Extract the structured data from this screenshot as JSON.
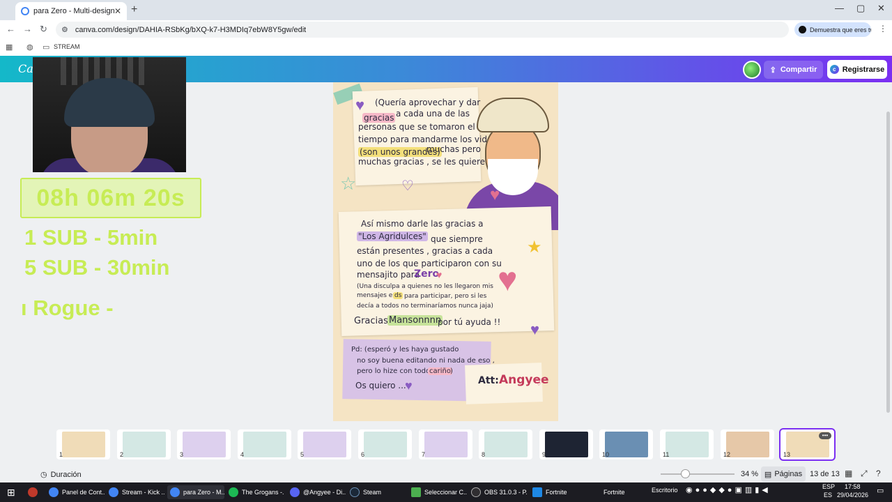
{
  "browser": {
    "tab_title": "para Zero - Multi-design",
    "tab_close": "✕",
    "new_tab": "+",
    "url": "canva.com/design/DAHIA-RSbKg/bXQ-k7-H3MDIq7ebW8Y5gw/edit",
    "profile_chip": "Demuestra que eres tú",
    "window_controls": [
      "—",
      "▢",
      "✕"
    ]
  },
  "bookmarks": {
    "folder_label": "STREAM"
  },
  "canva": {
    "logo": "Canva",
    "share_label": "Compartir",
    "register_label": "Registrarse",
    "colors": {
      "brand_start": "#14b8c9",
      "brand_end": "#7b2ff2",
      "timer": "#c7ec55"
    }
  },
  "overlay": {
    "timer": "08h 06m 20s",
    "line1": "1 SUB - 5min",
    "line2": "5 SUB - 30min",
    "line3": "ı Rogue -"
  },
  "design": {
    "note1": [
      "(Quería aprovechar y dar",
      "a cada una de las",
      "personas que se tomaron el",
      "tiempo para mandarme los videos",
      "muchas pero",
      "muchas gracias , se les quiere . )"
    ],
    "hl_gracias": "gracias",
    "hl_grandes": "(son unos grandes)",
    "note2": [
      "Así mismo darle las gracias a",
      "que siempre",
      "están presentes , gracias a cada",
      "uno de los que participaron con su",
      "mensajito para",
      "(Una disculpa a quienes no les llegaron mis",
      "mensajes en",
      "para participar, pero si les",
      "decía a todos no terminaríamos nunca jaja)"
    ],
    "hl_agridulces": "\"Los Agridulces\"",
    "zero": "Zero",
    "hl_ds": "ds",
    "thanks_prefix": "Gracias",
    "hl_mansonnnn": "Mansonnnn",
    "thanks_suffix": "por tú ayuda !!",
    "note3": [
      "Pd: (esperó y les haya gustado",
      "no soy buena editando ni nada de eso ,",
      "pero lo hize con todo mi",
      ")",
      "Os quiero ..."
    ],
    "hl_carino": "cariño",
    "att_label": "Att:",
    "att_name": "Angyee"
  },
  "thumbnails": [
    {
      "num": "1",
      "color": "#f0dcb8"
    },
    {
      "num": "2",
      "color": "#d4e8e4"
    },
    {
      "num": "3",
      "color": "#ddd0ee"
    },
    {
      "num": "4",
      "color": "#d4e8e4"
    },
    {
      "num": "5",
      "color": "#ddd0ee"
    },
    {
      "num": "6",
      "color": "#d4e8e4"
    },
    {
      "num": "7",
      "color": "#ddd0ee"
    },
    {
      "num": "8",
      "color": "#d4e8e4"
    },
    {
      "num": "9",
      "color": "#1e2433"
    },
    {
      "num": "10",
      "color": "#6a8fb3"
    },
    {
      "num": "11",
      "color": "#d4e8e4"
    },
    {
      "num": "12",
      "color": "#e6c8a8"
    },
    {
      "num": "13",
      "color": "#f0dcb8"
    }
  ],
  "footer": {
    "duration_label": "Duración",
    "zoom": "34 %",
    "pages_label": "Páginas",
    "page_count": "13 de 13"
  },
  "taskbar": {
    "items": [
      "Panel de Cont...",
      "Stream - Kick ...",
      "para Zero - M...",
      "The Grogans -...",
      "@Angyee - Di...",
      "Steam",
      "Seleccionar C...",
      "OBS 31.0.3 - P...",
      "Fortnite",
      "Fortnite"
    ],
    "desktop_label": "Escritorio",
    "lang_top": "ESP",
    "lang_bottom": "ES",
    "time": "17:58",
    "date": "29/04/2026"
  }
}
